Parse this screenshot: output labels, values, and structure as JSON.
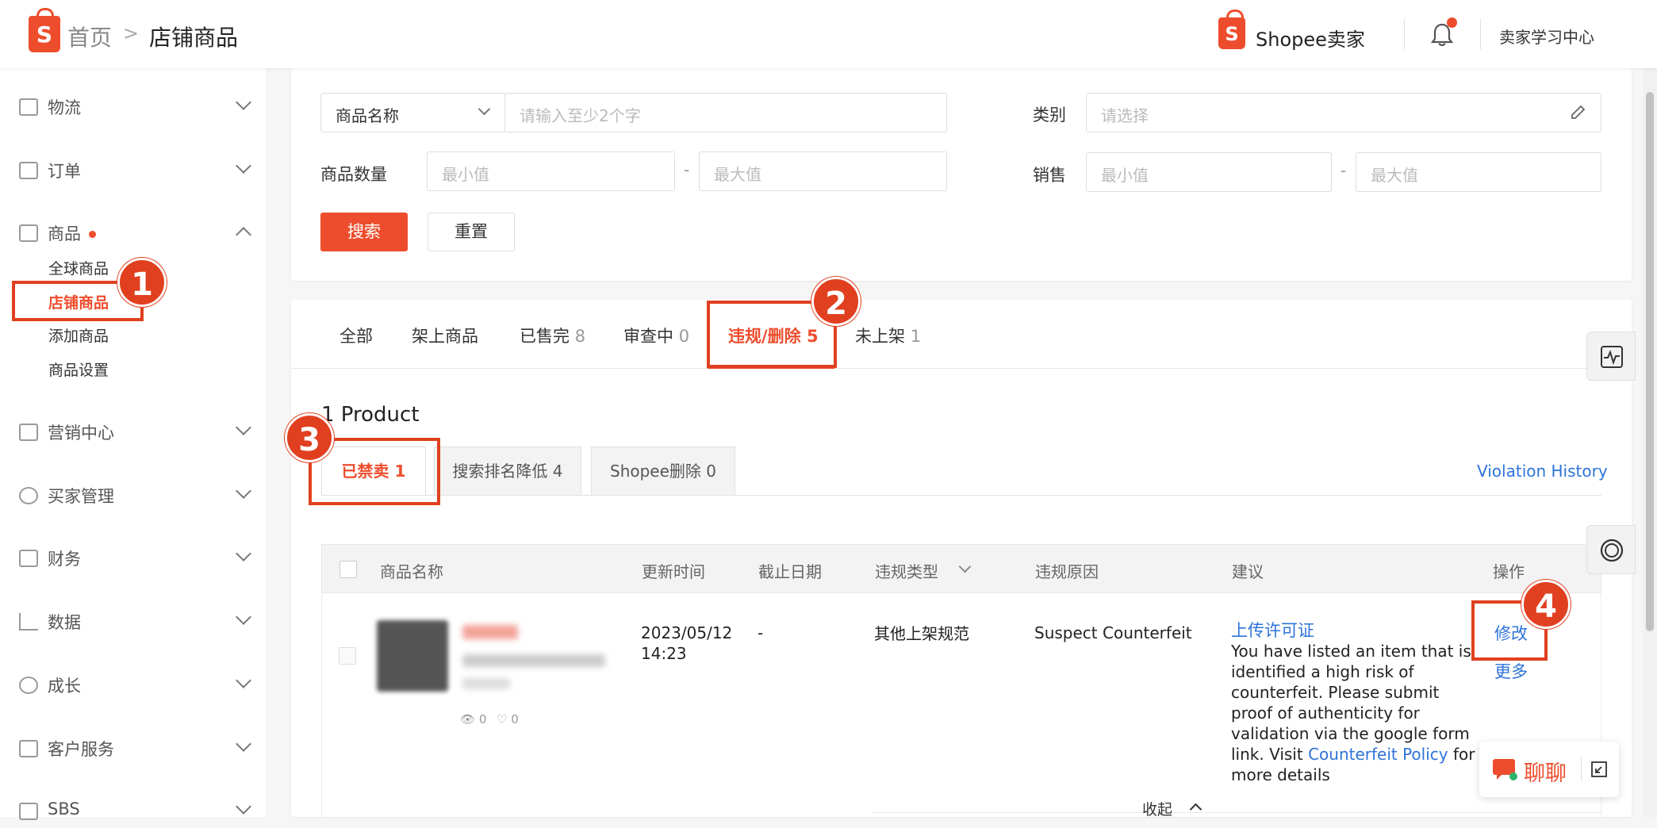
{
  "header": {
    "breadcrumb_home": "首页",
    "breadcrumb_sep": ">",
    "breadcrumb_current": "店铺商品",
    "logo_letter": "S",
    "brand": "Shopee卖家",
    "learning_center": "卖家学习中心"
  },
  "sidebar": {
    "items": [
      {
        "label": "物流"
      },
      {
        "label": "订单"
      },
      {
        "label": "商品"
      },
      {
        "label": "营销中心"
      },
      {
        "label": "买家管理"
      },
      {
        "label": "财务"
      },
      {
        "label": "数据"
      },
      {
        "label": "成长"
      },
      {
        "label": "客户服务"
      },
      {
        "label": "SBS"
      }
    ],
    "product_sub": [
      "全球商品",
      "店铺商品",
      "添加商品",
      "商品设置"
    ]
  },
  "filters": {
    "name_select": "商品名称",
    "name_placeholder": "请输入至少2个字",
    "category_label": "类别",
    "category_placeholder": "请选择",
    "qty_label": "商品数量",
    "min_placeholder": "最小值",
    "max_placeholder": "最大值",
    "dash": "-",
    "sales_label": "销售",
    "search_btn": "搜索",
    "reset_btn": "重置"
  },
  "tabs": [
    {
      "label": "全部",
      "count": ""
    },
    {
      "label": "架上商品",
      "count": ""
    },
    {
      "label": "已售完",
      "count": "8"
    },
    {
      "label": "审查中",
      "count": "0"
    },
    {
      "label": "违规/删除",
      "count": "5"
    },
    {
      "label": "未上架",
      "count": "1"
    }
  ],
  "product_count": "1 Product",
  "subtabs": [
    "已禁卖 1",
    "搜索排名降低 4",
    "Shopee删除 0"
  ],
  "violation_history": "Violation History",
  "table": {
    "headers": [
      "商品名称",
      "更新时间",
      "截止日期",
      "违规类型",
      "违规原因",
      "建议",
      "操作"
    ],
    "row": {
      "views": "0",
      "likes": "0",
      "update_date": "2023/05/12",
      "update_time": "14:23",
      "deadline": "-",
      "type": "其他上架规范",
      "reason": "Suspect Counterfeit",
      "suggestion_link": "上传许可证",
      "suggestion_text": "You have listed an item that is identified a high risk of counterfeit. Please submit proof of authenticity for validation via the google form link. Visit",
      "policy_link": "Counterfeit Policy",
      "suggestion_tail": "for more details",
      "action_edit": "修改",
      "action_more": "更多"
    },
    "collapse": "收起"
  },
  "annotations": [
    "1",
    "2",
    "3",
    "4"
  ],
  "chat": "聊聊",
  "colors": {
    "accent": "#ee4d2d",
    "link": "#2d73d9",
    "annotation": "#e0401f"
  }
}
